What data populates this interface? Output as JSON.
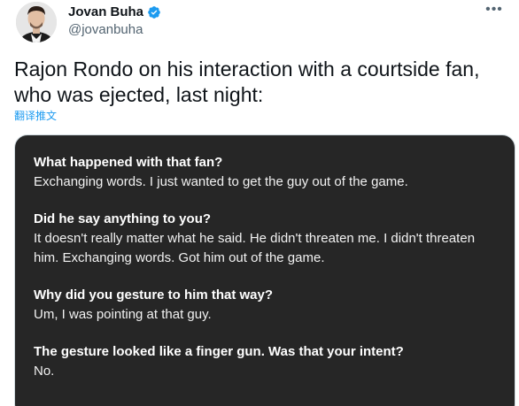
{
  "author": {
    "display_name": "Jovan Buha",
    "handle": "@jovanbuha"
  },
  "tweet": {
    "text": "Rajon Rondo on his interaction with a courtside fan, who was ejected, last night:",
    "translate_label": "翻译推文"
  },
  "media": {
    "qa": [
      {
        "question": "What happened with that fan?",
        "answer": "Exchanging words. I just wanted to get the guy out of the game."
      },
      {
        "question": "Did he say anything to you?",
        "answer": "It doesn't really matter what he said. He didn't threaten me. I didn't threaten him. Exchanging words. Got him out of the game."
      },
      {
        "question": "Why did you gesture to him that way?",
        "answer": "Um, I was pointing at that guy."
      },
      {
        "question": "The gesture looked like a finger gun. Was that your intent?",
        "answer": "No."
      }
    ]
  },
  "icons": {
    "verified": "verified-badge-icon",
    "more": "more-options-icon"
  },
  "colors": {
    "accent": "#1d9bf0",
    "media_background": "#262626",
    "secondary_text": "#536471"
  }
}
